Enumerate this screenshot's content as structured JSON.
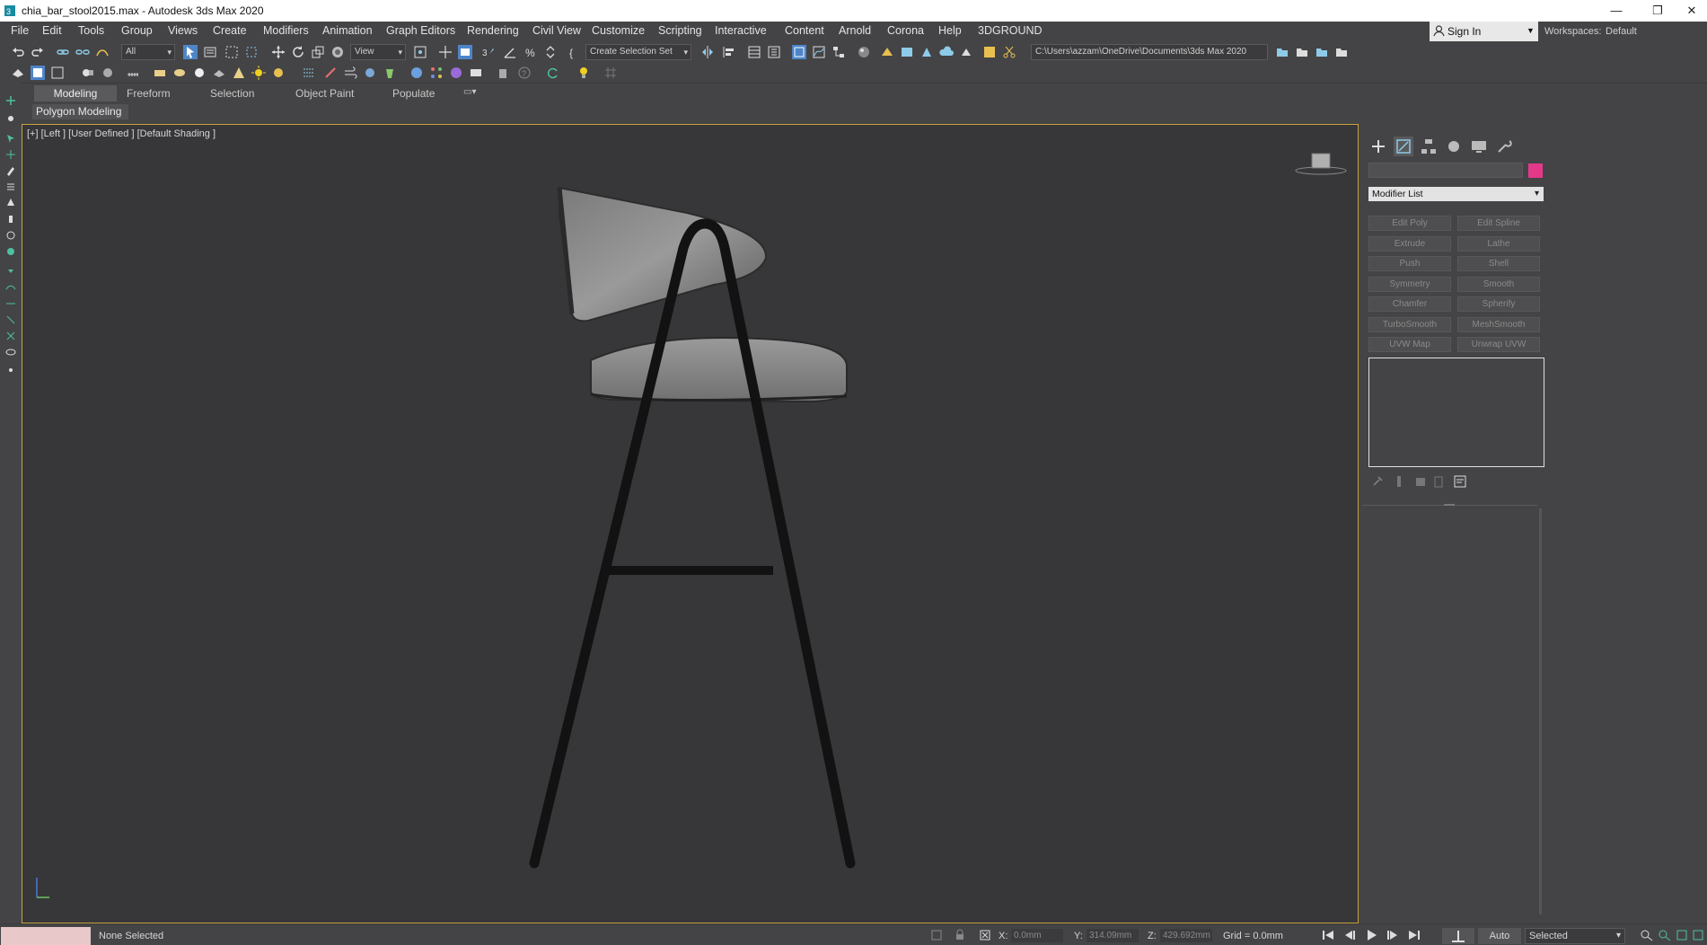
{
  "title_bar": {
    "title": "chia_bar_stool2015.max - Autodesk 3ds Max 2020",
    "minimize": "—",
    "restore": "❐",
    "close": "✕"
  },
  "menu": {
    "items": [
      "File",
      "Edit",
      "Tools",
      "Group",
      "Views",
      "Create",
      "Modifiers",
      "Animation",
      "Graph Editors",
      "Rendering",
      "Civil View",
      "Customize",
      "Scripting",
      "Interactive",
      "Content",
      "Arnold",
      "Corona",
      "Help",
      "3DGROUND"
    ],
    "sign_in": "Sign In",
    "workspaces_label": "Workspaces:",
    "workspaces_value": "Default"
  },
  "toolbar": {
    "selection_filter": "All",
    "reference_coord": "View",
    "selection_set": "Create Selection Set",
    "project_path": "C:\\Users\\azzam\\OneDrive\\Documents\\3ds Max 2020"
  },
  "ribbon": {
    "tabs": [
      "Modeling",
      "Freeform",
      "Selection",
      "Object Paint",
      "Populate"
    ],
    "active_tab": "Modeling",
    "panel_label": "Polygon Modeling"
  },
  "viewport": {
    "label": "[+] [Left ] [User Defined ] [Default Shading ]",
    "border_color": "#c6a13c"
  },
  "command_panel": {
    "tabs": [
      "create-icon",
      "modify-icon",
      "hierarchy-icon",
      "motion-icon",
      "display-icon",
      "utilities-icon"
    ],
    "object_color": "#e43889",
    "modifier_list": "Modifier List",
    "modifier_buttons": [
      [
        "Edit Poly",
        "Edit Spline"
      ],
      [
        "Extrude",
        "Lathe"
      ],
      [
        "Push",
        "Shell"
      ],
      [
        "Symmetry",
        "Smooth"
      ],
      [
        "Chamfer",
        "Spherify"
      ],
      [
        "TurboSmooth",
        "MeshSmooth"
      ],
      [
        "UVW Map",
        "Unwrap UVW"
      ]
    ]
  },
  "status_bar": {
    "selection_status": "None Selected",
    "x_label": "X:",
    "x_value": "0.0mm",
    "y_label": "Y:",
    "y_value": "314.09mm",
    "z_label": "Z:",
    "z_value": "429.692mm",
    "grid": "Grid = 0.0mm",
    "auto_key": "Auto",
    "key_filter": "Selected"
  }
}
